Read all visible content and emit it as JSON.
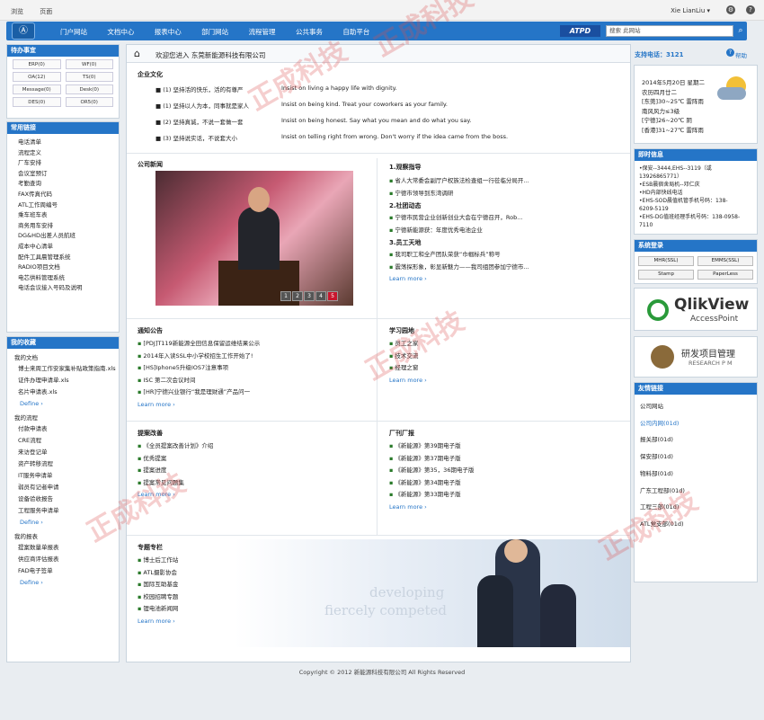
{
  "topbar": {
    "menu": [
      "浏览",
      "页面"
    ],
    "user": "Xie LianLiu ▾"
  },
  "nav": {
    "items": [
      "门户网站",
      "文档中心",
      "报表中心",
      "部门网站",
      "流程管理",
      "公共事务",
      "自助平台"
    ],
    "brand": "ATPD",
    "search_placeholder": "搜索 此网站"
  },
  "left": {
    "todo": {
      "title": "待办事宜",
      "items": [
        "ERP(0)",
        "WF(0)",
        "OA(12)",
        "TS(0)",
        "Message(0)",
        "Desk(0)",
        "DES(0)",
        "OR5(0)"
      ]
    },
    "links": {
      "title": "常用链接",
      "items": [
        "电话清单",
        "流程定义",
        "厂车安排",
        "会议室预订",
        "考勤查询",
        "FAX传真代码",
        "ATL工作周编号",
        "乘车班车表",
        "商务用车安排",
        "DG&HD出差人员航班",
        "成本中心清单",
        "配件工具晨管理系统",
        "RADIO项目文档",
        "电芯供料管理系统",
        "电话会议接入号码及说明"
      ]
    },
    "fav": {
      "title": "我的收藏",
      "docs_title": "我的文档",
      "docs": [
        "博士来周工作安家集补贴政策指南.xls",
        "证件办理申请单.xls",
        "名片申请表.xls"
      ],
      "define": "Define ›",
      "flows_title": "我的流程",
      "flows": [
        "付款申请表",
        "CRE流程",
        "来访登记单",
        "资产转移流程",
        "IT服务申请单",
        "弱员有记者申请",
        "设备验收报告",
        "工程服务申请单"
      ],
      "reports_title": "我的报表",
      "reports": [
        "提案数量单报表",
        "供应商评估报表",
        "FAD电子签单"
      ]
    }
  },
  "main": {
    "crumb": "欢迎您进入 东莞新能源科技有限公司",
    "phone": "支持电话：3121",
    "help": "帮助",
    "culture": {
      "title": "企业文化",
      "rows": [
        {
          "cn": "■ (1) 坚持活的快乐，活的有尊严",
          "en": "Insist on living a happy life with dignity."
        },
        {
          "cn": "■ (1) 坚持以人为本，同事就是家人",
          "en": "Insist on being kind. Treat your coworkers as your family."
        },
        {
          "cn": "■ (2) 坚持真诚，不说一套做一套",
          "en": "Insist on being honest. Say what you mean and do what you say."
        },
        {
          "cn": "■ (3) 坚持说实话，不说套大小",
          "en": "Insist on telling right from wrong. Don't worry if the idea came  from the boss."
        }
      ]
    },
    "news": {
      "title": "公司新闻",
      "pages": [
        "1",
        "2",
        "3",
        "4",
        "5"
      ]
    },
    "news_right": {
      "h1": "1.观察指导",
      "a1": [
        "省人大常委会副厅户权族法检查组一行莅临分局开...",
        "宁德市领导到东湾调研"
      ],
      "h2": "2.社团动态",
      "a2": [
        "宁德市民营企业创新创业大会在宁德召开，Rob...",
        "宁德新能源获：年度优秀电池企业"
      ],
      "h3": "3.员工天地",
      "a3": [
        "我司职工和全产团队荣获“巾帼标兵”称号",
        "震荡探形象，彰显新魅力——我司组团参加宁德市..."
      ],
      "more": "Learn more ›"
    },
    "notice": {
      "title": "通知公告",
      "items": [
        "[PDJ]T119新能源全田信息保留运维结果公示",
        "2014年入读SSL中小学校招生工作开始了!",
        "[HS]Iphone5升级IOS7注意事项",
        "ISC 第二次会议时间",
        "[HR]宁德兴业银行“我是理财通”产品问一"
      ],
      "more": "Learn more ›"
    },
    "study": {
      "title": "学习园地",
      "items": [
        "员工之家",
        "技术交流",
        "经理之窗"
      ],
      "more": "Learn more ›"
    },
    "proposal": {
      "title": "提案改善",
      "items": [
        "《全员提案改善计划》介绍",
        "优秀提案",
        "提案进度",
        "提案常见问题集"
      ],
      "more": "Learn more ›"
    },
    "journal": {
      "title": "厂刊厂报",
      "items": [
        "《新能源》第39期电子版",
        "《新能源》第37期电子版",
        "《新能源》第35，36期电子版",
        "《新能源》第34期电子版",
        "《新能源》第33期电子版"
      ],
      "more": "Learn more ›"
    },
    "special": {
      "title": "专题专栏",
      "items": [
        "博士后工作站",
        "ATL摄影协会",
        "国际互助基金",
        "校园招聘专题",
        "锂电池新闻网"
      ],
      "more": "Learn more ›"
    },
    "slogan": [
      "developing",
      "fiercely competed"
    ]
  },
  "right": {
    "weather": [
      "2014年5月20日 星期二",
      "农历四月廿二",
      "[东莞]30~25℃ 雷阵雨",
      "南风风力≤3级",
      "[宁德]26~20℃ 阴",
      "[香港]31~27℃ 雷阵雨"
    ],
    "contact": {
      "title": "即时信息",
      "lines": [
        "•保安--3444,EHS--3119（或",
        "13926865771）",
        "•ESB晨宿舍局机--邓仁庆",
        "•HD内部快线电话",
        "•EHS-SOD晨值机管手机号码：138-",
        "6209-5119",
        "•EHS-DG值班经理手机号码：138-0958-",
        "7110"
      ]
    },
    "login": {
      "title": "系统登录",
      "btns": [
        "MHR(SSL)",
        "EMMS(SSL)",
        "Stamp",
        "PaperLess"
      ]
    },
    "qlik": {
      "brand": "QlikView",
      "sub": "AccessPoint"
    },
    "rd": {
      "title": "研发项目管理",
      "sub": "RESEARCH P M"
    },
    "friends": {
      "title": "友情链接",
      "items": [
        "公司网站",
        "公司内网(01d)",
        "报关部(01d)",
        "保安部(01d)",
        "物料部(01d)",
        "广东工程部(01d)",
        "工程三部(01d)",
        "ATL党支部(01d)"
      ]
    }
  },
  "watermark": "正成科技",
  "footer": "Copyright © 2012 新能源科技有限公司 All Rights Reserved"
}
